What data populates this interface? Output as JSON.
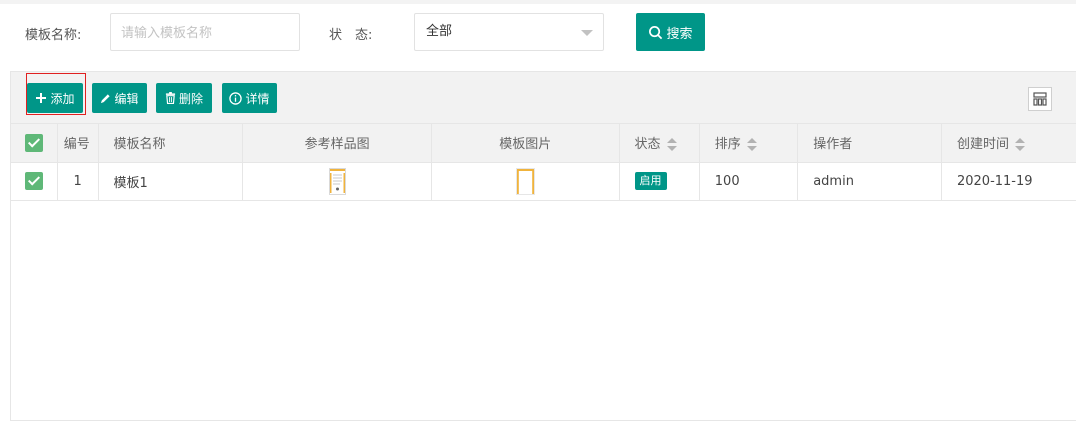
{
  "search": {
    "name_label": "模板名称:",
    "name_placeholder": "请输入模板名称",
    "status_label": "状　态:",
    "status_value": "全部",
    "search_button": "搜索"
  },
  "toolbar": {
    "add": "添加",
    "edit": "编辑",
    "delete": "删除",
    "detail": "详情"
  },
  "table": {
    "headers": {
      "id": "编号",
      "name": "模板名称",
      "sample": "参考样品图",
      "image": "模板图片",
      "status": "状态",
      "sort": "排序",
      "operator": "操作者",
      "created": "创建时间"
    },
    "rows": [
      {
        "id": "1",
        "name": "模板1",
        "status": "启用",
        "sort": "100",
        "operator": "admin",
        "created": "2020-11-19"
      }
    ]
  },
  "colors": {
    "primary": "#009688",
    "checkbox": "#5fb878",
    "highlight": "#e02020"
  },
  "icons": [
    "plus-icon",
    "pencil-icon",
    "trash-icon",
    "info-icon",
    "search-icon",
    "columns-icon"
  ]
}
